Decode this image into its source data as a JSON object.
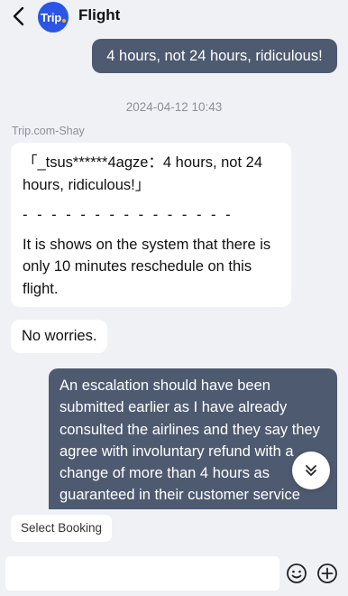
{
  "header": {
    "logo_text": "Trip",
    "title": "Flight"
  },
  "messages": {
    "out_1": "4 hours, not 24 hours, ridiculous!",
    "timestamp": "2024-04-12  10:43",
    "sender": "Trip.com-Shay",
    "reply": {
      "quote_lines": [
        "「_tsus******4agze：4 hours, not 24",
        "hours, ridiculous!」"
      ],
      "divider": "- - - - - - - - - - - - - - -",
      "body_lines": [
        "It is shows on the system that there is",
        "only 10 minutes reschedule on this",
        "flight."
      ]
    },
    "in_2": "No worries.",
    "out_2_lines": [
      "An escalation should have been",
      "submitted earlier as I have already",
      "consulted the airlines and they say they",
      "agree with involuntary refund with a",
      "change of more than 4 hours as",
      "guaranteed in their customer service"
    ]
  },
  "footer": {
    "quick_action": "Select Booking",
    "input_placeholder": ""
  },
  "colors": {
    "background": "#eff1f5",
    "outgoing_bubble": "#4e5a70",
    "brand": "#2a55e5"
  },
  "icons": {
    "back": "chevron-left-icon",
    "scroll": "double-chevron-down-icon",
    "emoji": "smiley-icon",
    "add": "plus-circle-icon"
  }
}
